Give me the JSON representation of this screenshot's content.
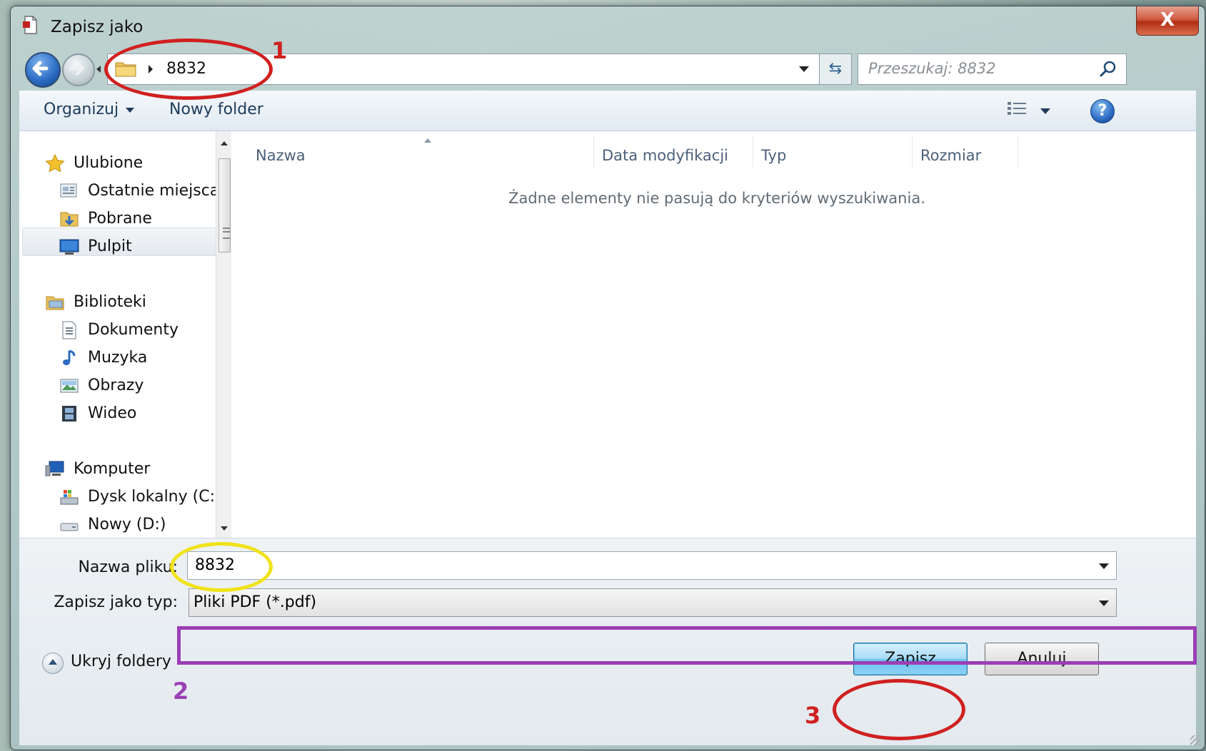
{
  "window": {
    "title": "Zapisz jako",
    "close_label": "X"
  },
  "address": {
    "path": "8832"
  },
  "search": {
    "placeholder": "Przeszukaj: 8832"
  },
  "toolbar": {
    "organize": "Organizuj",
    "new_folder": "Nowy folder",
    "help": "?"
  },
  "navigation": {
    "favorites": {
      "label": "Ulubione",
      "items": [
        {
          "label": "Ostatnie miejsca",
          "icon": "recent-places-icon"
        },
        {
          "label": "Pobrane",
          "icon": "downloads-icon"
        },
        {
          "label": "Pulpit",
          "icon": "desktop-icon",
          "selected": true
        }
      ]
    },
    "libraries": {
      "label": "Biblioteki",
      "items": [
        {
          "label": "Dokumenty",
          "icon": "documents-icon"
        },
        {
          "label": "Muzyka",
          "icon": "music-icon"
        },
        {
          "label": "Obrazy",
          "icon": "pictures-icon"
        },
        {
          "label": "Wideo",
          "icon": "video-icon"
        }
      ]
    },
    "computer": {
      "label": "Komputer",
      "items": [
        {
          "label": "Dysk lokalny (C:)",
          "icon": "local-disk-icon"
        },
        {
          "label": "Nowy (D:)",
          "icon": "drive-icon"
        }
      ]
    }
  },
  "file_list": {
    "columns": [
      "Nazwa",
      "Data modyfikacji",
      "Typ",
      "Rozmiar"
    ],
    "empty_message": "Żadne elementy nie pasują do kryteriów wyszukiwania."
  },
  "form": {
    "filename_label": "Nazwa pliku:",
    "filename_value": "8832",
    "filetype_label": "Zapisz jako typ:",
    "filetype_value": "Pliki PDF (*.pdf)"
  },
  "footer": {
    "hide_folders": "Ukryj foldery",
    "save": "Zapisz",
    "cancel": "Anuluj"
  },
  "annotations": [
    {
      "number": "1",
      "color": "#d02020"
    },
    {
      "number": "2",
      "color": "#9b3fb5"
    },
    {
      "number": "3",
      "color": "#d02020"
    }
  ],
  "colors": {
    "annotation_red": "#d02020",
    "annotation_yellow": "#f0e21a",
    "annotation_purple": "#9b3fb5"
  }
}
